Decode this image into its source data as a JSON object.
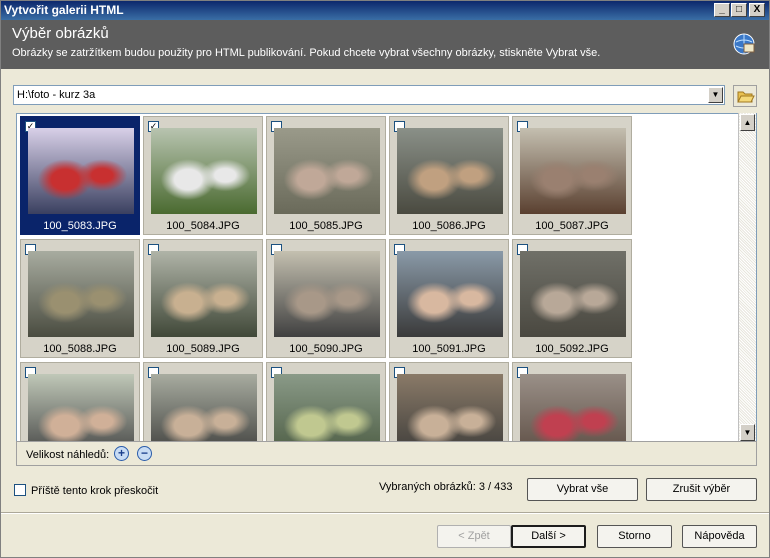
{
  "window": {
    "title": "Vytvořit galerii HTML",
    "min": "_",
    "max": "□",
    "close": "X"
  },
  "header": {
    "title": "Výběr obrázků",
    "subtitle": "Obrázky se zatržítkem budou použity pro HTML publikování. Pokud chcete vybrat všechny obrázky, stiskněte Vybrat vše.",
    "icon": "gallery-globe-icon"
  },
  "path": {
    "value": "H:\\foto - kurz 3a",
    "dropdown_icon": "▼",
    "browse_icon": "folder-open-icon"
  },
  "grid": {
    "items": [
      {
        "name": "100_5083.JPG",
        "checked": true,
        "selected": true,
        "c1": "#d8d0e8",
        "c2": "#3a4060",
        "c3": "#c83030"
      },
      {
        "name": "100_5084.JPG",
        "checked": true,
        "selected": false,
        "c1": "#b8c4b0",
        "c2": "#4a6a30",
        "c3": "#e8e8e8"
      },
      {
        "name": "100_5085.JPG",
        "checked": false,
        "selected": false,
        "c1": "#9a9a8a",
        "c2": "#6a6a5a",
        "c3": "#c0a898"
      },
      {
        "name": "100_5086.JPG",
        "checked": false,
        "selected": false,
        "c1": "#8a9088",
        "c2": "#4a4a40",
        "c3": "#c0a080"
      },
      {
        "name": "100_5087.JPG",
        "checked": false,
        "selected": false,
        "c1": "#c4bfb0",
        "c2": "#5a4030",
        "c3": "#9a8070"
      },
      {
        "name": "100_5088.JPG",
        "checked": false,
        "selected": false,
        "c1": "#a8aca0",
        "c2": "#4a4c40",
        "c3": "#9a9070"
      },
      {
        "name": "100_5089.JPG",
        "checked": false,
        "selected": false,
        "c1": "#b0b4a8",
        "c2": "#404838",
        "c3": "#c8b090"
      },
      {
        "name": "100_5090.JPG",
        "checked": false,
        "selected": false,
        "c1": "#c4c0b0",
        "c2": "#404040",
        "c3": "#a89888"
      },
      {
        "name": "100_5091.JPG",
        "checked": false,
        "selected": false,
        "c1": "#8a9aa8",
        "c2": "#3a3a3a",
        "c3": "#d8b8a0"
      },
      {
        "name": "100_5092.JPG",
        "checked": false,
        "selected": false,
        "c1": "#707068",
        "c2": "#4a4840",
        "c3": "#b8a898"
      },
      {
        "name": "",
        "checked": false,
        "selected": false,
        "c1": "#c0c8b8",
        "c2": "#404040",
        "c3": "#d0b098"
      },
      {
        "name": "",
        "checked": false,
        "selected": false,
        "c1": "#a8aca0",
        "c2": "#3a3a38",
        "c3": "#c8b098"
      },
      {
        "name": "",
        "checked": false,
        "selected": false,
        "c1": "#8a9a88",
        "c2": "#4a5a40",
        "c3": "#c0c890"
      },
      {
        "name": "",
        "checked": false,
        "selected": false,
        "c1": "#8a7a68",
        "c2": "#3a3a38",
        "c3": "#c8b098"
      },
      {
        "name": "",
        "checked": false,
        "selected": false,
        "c1": "#9a9088",
        "c2": "#5a4a40",
        "c3": "#c04050"
      }
    ],
    "scroll_up": "▲",
    "scroll_down": "▼"
  },
  "zoom": {
    "label": "Velikost náhledů:",
    "in_icon": "zoom-in-icon",
    "out_icon": "zoom-out-icon",
    "in_glyph": "+",
    "out_glyph": "−"
  },
  "skip": {
    "label": "Příště tento krok přeskočit",
    "checked": false
  },
  "status": {
    "count_text": "Vybraných obrázků: 3 / 433"
  },
  "buttons": {
    "select_all": "Vybrat vše",
    "clear_selection": "Zrušit výběr",
    "back": "< Zpět",
    "next": "Další >",
    "cancel": "Storno",
    "help": "Nápověda"
  },
  "colors": {
    "titlebar": "#0a246a",
    "header": "#5d5d5d",
    "selection": "#0a246a",
    "face": "#ece9d8"
  }
}
